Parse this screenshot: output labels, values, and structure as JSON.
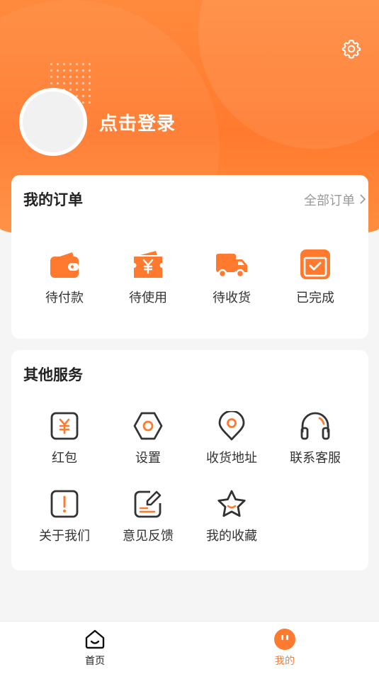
{
  "theme": {
    "accent": "#ff7a2e",
    "icon_dark": "#333333"
  },
  "header": {
    "login_text": "点击登录",
    "settings_icon": "gear-icon"
  },
  "orders": {
    "title": "我的订单",
    "all_label": "全部订单",
    "items": [
      {
        "label": "待付款",
        "icon": "wallet-icon"
      },
      {
        "label": "待使用",
        "icon": "ticket-icon"
      },
      {
        "label": "待收货",
        "icon": "truck-icon"
      },
      {
        "label": "已完成",
        "icon": "completed-box-icon"
      }
    ]
  },
  "services": {
    "title": "其他服务",
    "items": [
      {
        "label": "红包",
        "icon": "red-packet-icon"
      },
      {
        "label": "设置",
        "icon": "settings-hex-icon"
      },
      {
        "label": "收货地址",
        "icon": "location-pin-icon"
      },
      {
        "label": "联系客服",
        "icon": "headset-icon"
      },
      {
        "label": "关于我们",
        "icon": "info-icon"
      },
      {
        "label": "意见反馈",
        "icon": "feedback-icon"
      },
      {
        "label": "我的收藏",
        "icon": "star-icon"
      }
    ]
  },
  "tabbar": {
    "items": [
      {
        "label": "首页",
        "icon": "home-icon",
        "active": false
      },
      {
        "label": "我的",
        "icon": "mine-icon",
        "active": true
      }
    ]
  }
}
